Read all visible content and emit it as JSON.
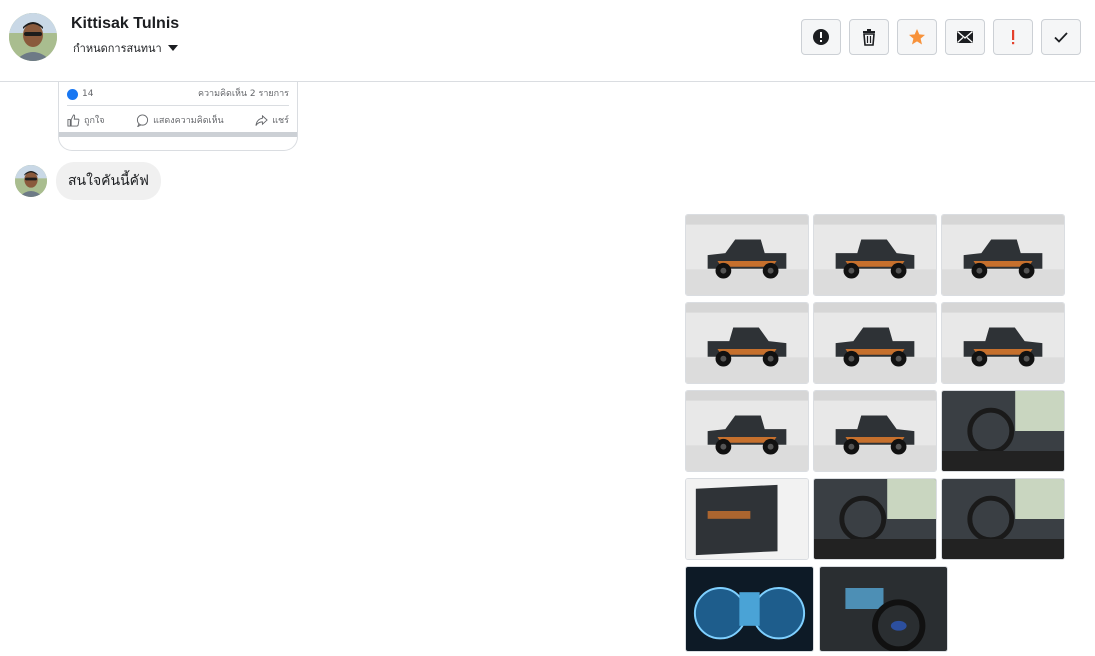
{
  "header": {
    "contact_name": "Kittisak Tulnis",
    "assign_label": "กำหนดการสนทนา",
    "actions": [
      {
        "name": "alert-button",
        "icon": "exclamation-circle-icon"
      },
      {
        "name": "delete-button",
        "icon": "trash-icon"
      },
      {
        "name": "star-button",
        "icon": "star-icon"
      },
      {
        "name": "mail-button",
        "icon": "envelope-icon"
      },
      {
        "name": "priority-button",
        "icon": "exclamation-icon"
      },
      {
        "name": "done-button",
        "icon": "check-icon"
      }
    ],
    "star_color": "#f7923b",
    "priority_color": "#e4402b"
  },
  "shared_post": {
    "like_count": "14",
    "comment_count": "ความคิดเห็น 2 รายการ",
    "like_label": "ถูกใจ",
    "comment_label": "แสดงความคิดเห็น",
    "share_label": "แชร์"
  },
  "message": {
    "text": "สนใจคันนี้คัฟ"
  },
  "photos": [
    {
      "subject": "pickup-front"
    },
    {
      "subject": "pickup-front-angle"
    },
    {
      "subject": "pickup-rear-angle"
    },
    {
      "subject": "pickup-rear-left"
    },
    {
      "subject": "pickup-rear"
    },
    {
      "subject": "pickup-side"
    },
    {
      "subject": "pickup-side-left"
    },
    {
      "subject": "pickup-wheel"
    },
    {
      "subject": "interior-steering"
    },
    {
      "subject": "interior-door"
    },
    {
      "subject": "interior-seats"
    },
    {
      "subject": "interior-rear-seats"
    },
    {
      "subject": "instrument-cluster"
    },
    {
      "subject": "dashboard"
    }
  ]
}
